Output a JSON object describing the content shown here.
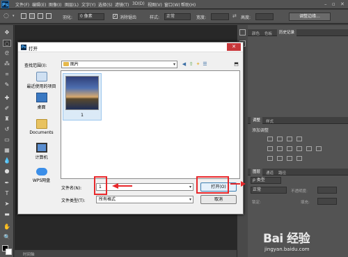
{
  "app": {
    "logo": "Ps"
  },
  "menu": [
    "文件(F)",
    "编辑(E)",
    "图像(I)",
    "图层(L)",
    "文字(Y)",
    "选择(S)",
    "滤镜(T)",
    "3D(D)",
    "视图(V)",
    "窗口(W)",
    "帮助(H)"
  ],
  "options": {
    "feather_label": "羽化:",
    "feather_value": "0 像素",
    "antialias_label": "消除锯齿",
    "style_label": "样式:",
    "style_value": "正常",
    "width_label": "宽度:",
    "height_label": "高度:",
    "refine_edge": "调整边缘..."
  },
  "panels": {
    "top_tabs": [
      "颜色",
      "色板",
      "历史记录"
    ],
    "adjust_tabs": [
      "调整",
      "样式"
    ],
    "adjust_title": "添加调整",
    "layer_tabs": [
      "图层",
      "通道",
      "路径"
    ],
    "layer_kind": "ρ 类型",
    "blend_mode": "正常",
    "opacity_label": "不透明度:",
    "lock_label": "锁定:",
    "fill_label": "填充:"
  },
  "dialog": {
    "title": "打开",
    "close": "✕",
    "lookin_label": "查找范围(I):",
    "lookin_value": "图片",
    "places": [
      {
        "label": "最近使用的项目",
        "icon": "recent-icon"
      },
      {
        "label": "桌面",
        "icon": "desktop-icon"
      },
      {
        "label": "Documents",
        "icon": "folder-icon"
      },
      {
        "label": "计算机",
        "icon": "computer-icon"
      },
      {
        "label": "WPS网盘",
        "icon": "cloud-icon"
      }
    ],
    "file_item": "1",
    "filename_label": "文件名(N):",
    "filename_value": "1",
    "filetype_label": "文件类型(T):",
    "filetype_value": "所有格式",
    "open_button": "打开(O)",
    "cancel_button": "取消"
  },
  "statusbar": {
    "label": "时间轴"
  },
  "watermark": {
    "brand": "Bai 经验",
    "url": "jingyan.baidu.com"
  },
  "colors": {
    "annotation": "#e8272a",
    "ps_bg": "#535353",
    "dialog_bg": "#f0f0f0"
  }
}
